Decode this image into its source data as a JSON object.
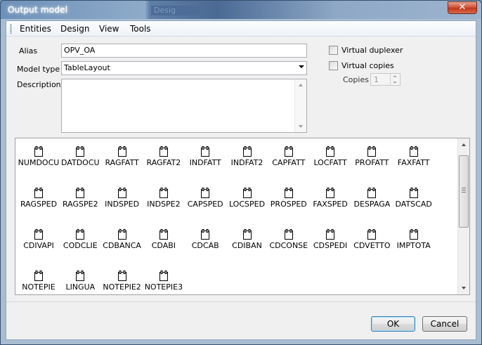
{
  "window": {
    "title": "Output model",
    "background_title": "Desig",
    "close_symbol": "✕"
  },
  "menu": {
    "items": [
      "Entities",
      "Design",
      "View",
      "Tools"
    ]
  },
  "form": {
    "alias_label": "Alias",
    "alias_value": "OPV_OA",
    "model_type_label": "Model type",
    "model_type_value": "TableLayout",
    "description_label": "Description",
    "description_value": ""
  },
  "options": {
    "virtual_duplexer_label": "Virtual duplexer",
    "virtual_duplexer_checked": false,
    "virtual_copies_label": "Virtual copies",
    "virtual_copies_checked": false,
    "copies_label": "Copies",
    "copies_value": "1"
  },
  "entities": [
    [
      "NUMDOCU",
      "DATDOCU",
      "RAGFATT",
      "RAGFAT2",
      "INDFATT",
      "INDFAT2",
      "CAPFATT",
      "LOCFATT",
      "PROFATT",
      "FAXFATT"
    ],
    [
      "RAGSPED",
      "RAGSPE2",
      "INDSPED",
      "INDSPE2",
      "CAPSPED",
      "LOCSPED",
      "PROSPED",
      "FAXSPED",
      "DESPAGA",
      "DATSCAD"
    ],
    [
      "CDIVAPI",
      "CODCLIE",
      "CDBANCA",
      "CDABI",
      "CDCAB",
      "CDIBAN",
      "CDCONSE",
      "CDSPEDI",
      "CDVETTO",
      "IMPTOTA"
    ],
    [
      "NOTEPIE",
      "LINGUA",
      "NOTEPIE2",
      "NOTEPIE3"
    ]
  ],
  "buttons": {
    "ok": "OK",
    "cancel": "Cancel"
  }
}
